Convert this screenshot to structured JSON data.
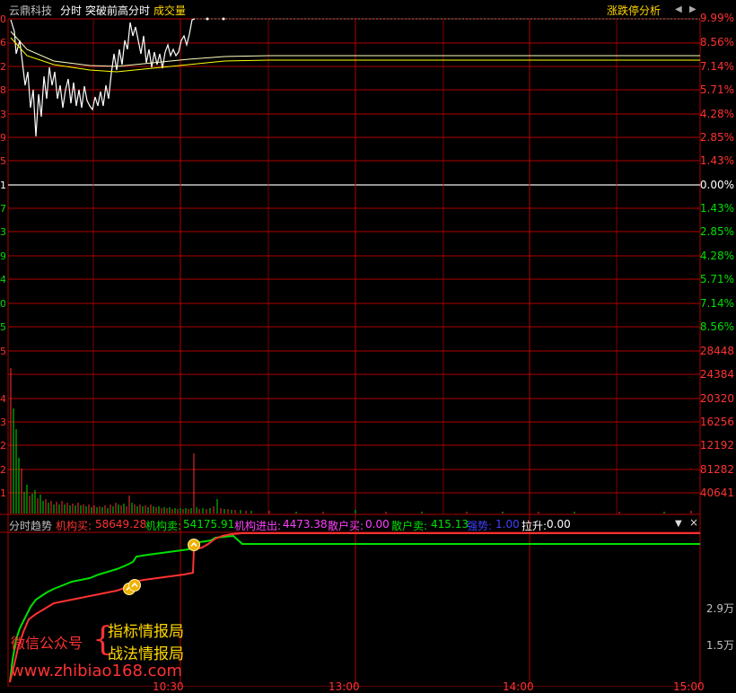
{
  "header": {
    "stock_name": "云鼎科技",
    "mode_tabs": [
      "分时",
      "突破前高分时"
    ],
    "volume_label": "成交量",
    "limit_analysis": "涨跌停分析",
    "ctrl_left": "◀",
    "ctrl_right": "▶"
  },
  "right_axis": {
    "up_pct": [
      "9.99%",
      "8.56%",
      "7.14%",
      "5.71%",
      "4.28%",
      "2.85%",
      "1.43%"
    ],
    "zero_pct": "0.00%",
    "down_pct": [
      "1.43%",
      "2.85%",
      "4.28%",
      "5.71%",
      "7.14%",
      "8.56%"
    ],
    "volume": [
      "28448",
      "24384",
      "20320",
      "16256",
      "12192",
      "81282",
      "40641"
    ],
    "indicator": [
      "2.9万",
      "1.5万"
    ]
  },
  "left_axis_fragments": [
    "0",
    "6",
    "2",
    "8",
    "3",
    "9",
    "5",
    "1",
    "7",
    "3",
    "9",
    "4",
    "0",
    "5",
    "5",
    "4",
    "3",
    "2",
    "2",
    "1"
  ],
  "time_axis_fragments": [
    "10:30",
    "13:00",
    "14:00",
    "15:00"
  ],
  "indicator_bar": {
    "name": "分时趋势",
    "inst_buy_label": "机构买:",
    "inst_buy_value": "58649.28",
    "inst_sell_label": "机构卖:",
    "inst_sell_value": "54175.91",
    "inst_net_label": "机构进出:",
    "inst_net_value": "4473.38",
    "retail_buy_label": "散户买:",
    "retail_buy_value": "0.00",
    "retail_sell_label": "散户卖:",
    "retail_sell_value": "415.13",
    "strong_label": "强势:",
    "strong_value": "1.00",
    "pull_label": "拉升:",
    "pull_value": "0.00",
    "dropdown_icon": "▼",
    "close_icon": "×"
  },
  "watermark": {
    "wechat": "微信公众号",
    "brace": "{",
    "line1": "指标情报局",
    "line2": "战法情报局",
    "url": "www.zhibiao168.com"
  },
  "colors": {
    "grid": "#b00000",
    "up": "#ff3232",
    "down": "#00e000",
    "price": "#ffffff",
    "avg": "#ffff00",
    "magenta": "#ff40ff",
    "blue": "#4040ff",
    "yellow": "#ffd700"
  }
}
